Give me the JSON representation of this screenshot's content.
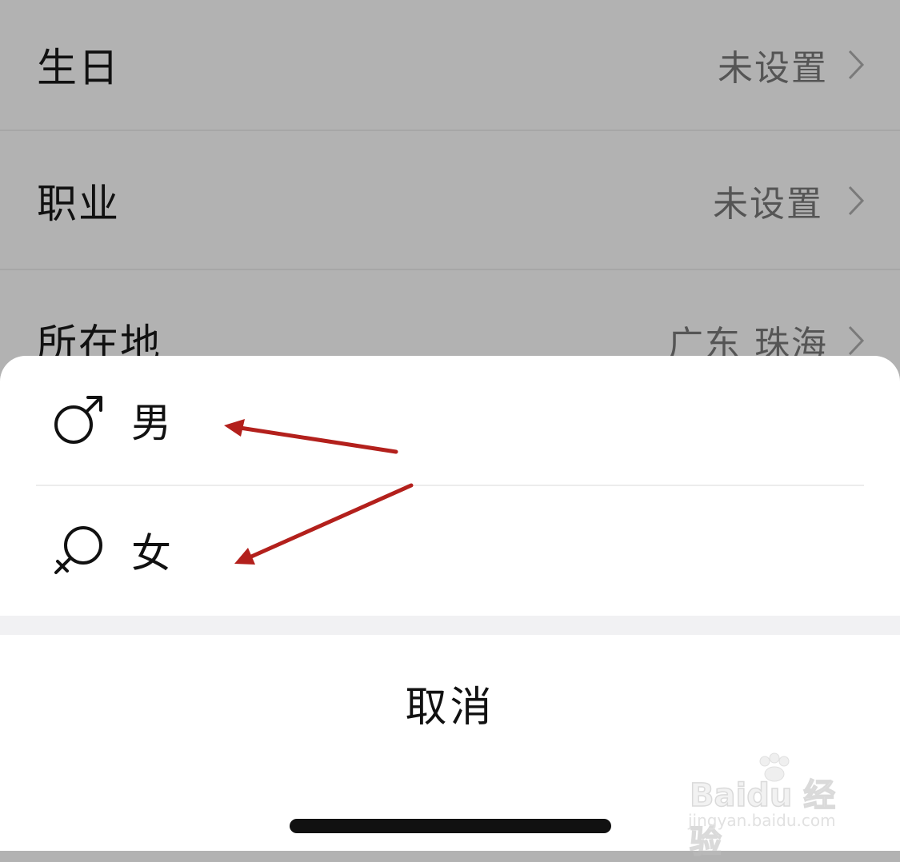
{
  "settings": {
    "rows": [
      {
        "label": "生日",
        "value": "未设置"
      },
      {
        "label": "职业",
        "value": "未设置"
      },
      {
        "label": "所在地",
        "value": "广东 珠海"
      }
    ]
  },
  "sheet": {
    "options": [
      {
        "label": "男",
        "icon": "male-icon"
      },
      {
        "label": "女",
        "icon": "female-icon"
      }
    ],
    "cancel_label": "取消"
  },
  "annotations": {
    "arrow_color": "#b3201c"
  },
  "watermark": {
    "brand": "Baidu 经验",
    "url": "jingyan.baidu.com"
  }
}
